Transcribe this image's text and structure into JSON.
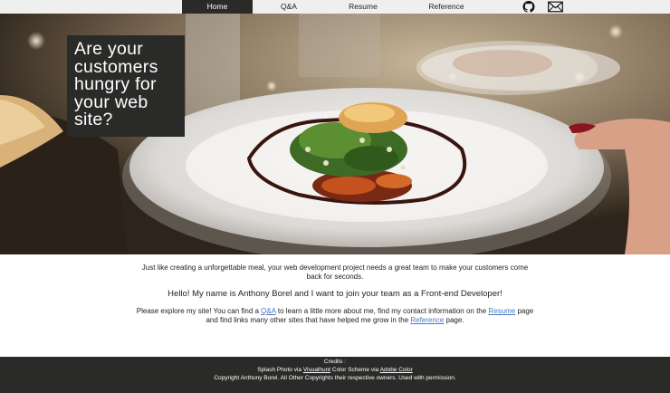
{
  "nav": {
    "items": [
      {
        "label": "Home",
        "active": true
      },
      {
        "label": "Q&A",
        "active": false
      },
      {
        "label": "Resume",
        "active": false
      },
      {
        "label": "Reference",
        "active": false
      }
    ],
    "icons": [
      "github-icon",
      "mail-icon"
    ]
  },
  "hero": {
    "title": "Are your customers hungry for your web site?"
  },
  "content": {
    "intro": "Just like creating a unforgettable meal, your web development project needs a great team to make your customers come back for seconds.",
    "hello": "Hello! My name is Anthony Borel and I want to join your team as a Front-end Developer!",
    "explore": {
      "p1": "Please explore my site! You can find a ",
      "link_qa": "Q&A",
      "p2": " to learn a little more about me, find my contact information on the ",
      "link_resume": "Resume",
      "p3": " page and find links many other sites that have helped me grow in the ",
      "link_reference": "Reference",
      "p4": " page."
    }
  },
  "footer": {
    "credits": "Credits :",
    "line2_a": "Splash Photo via ",
    "visualhunt": "Visualhunt",
    "line2_b": " Color Scheme via ",
    "adobe": "Adobe Color",
    "copyright": "Copyright Anthony Borel. All Other Copyrights their respective owners. Used with permission."
  },
  "colors": {
    "nav_bg": "#efefef",
    "dark": "#2a2a28",
    "link": "#4a78c0"
  }
}
